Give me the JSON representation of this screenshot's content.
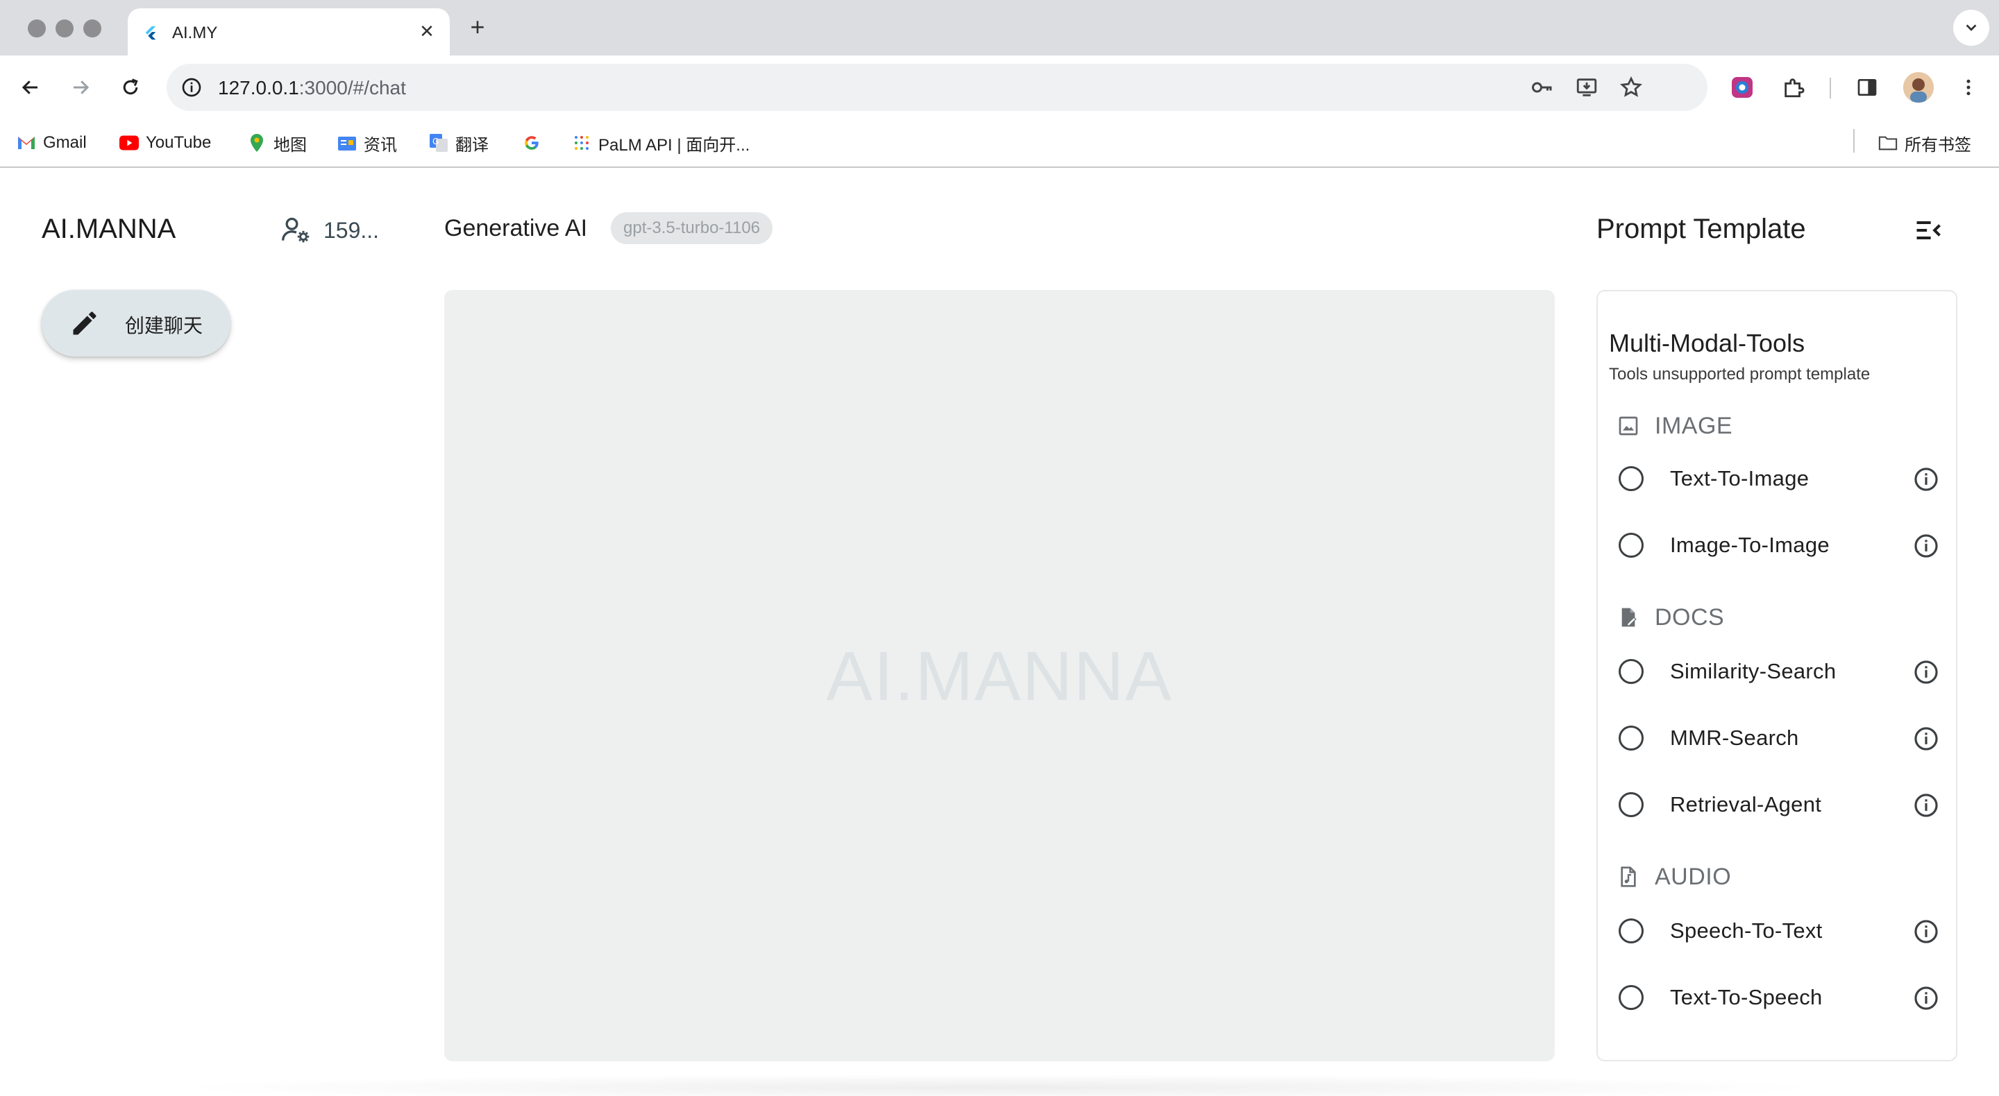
{
  "browser": {
    "tab_title": "AI.MY",
    "url_host": "127.0.0.1",
    "url_rest": ":3000/#/chat",
    "bookmarks": [
      "Gmail",
      "YouTube",
      "地图",
      "资讯",
      "翻译",
      "PaLM API | 面向开..."
    ],
    "all_bookmarks_label": "所有书签"
  },
  "sidebar": {
    "app_title": "AI.MANNA",
    "user_count": "159...",
    "new_chat_label": "创建聊天"
  },
  "main": {
    "title": "Generative AI",
    "model": "gpt-3.5-turbo-1106",
    "watermark": "AI.MANNA"
  },
  "panel": {
    "title": "Prompt Template",
    "heading": "Multi-Modal-Tools",
    "subtitle": "Tools unsupported prompt template",
    "sections": [
      {
        "label": "IMAGE",
        "icon": "image-icon",
        "options": [
          "Text-To-Image",
          "Image-To-Image"
        ]
      },
      {
        "label": "DOCS",
        "icon": "document-icon",
        "options": [
          "Similarity-Search",
          "MMR-Search",
          "Retrieval-Agent"
        ]
      },
      {
        "label": "AUDIO",
        "icon": "audio-file-icon",
        "options": [
          "Speech-To-Text",
          "Text-To-Speech"
        ]
      }
    ]
  },
  "colors": {
    "chat_bg": "#eef0f0",
    "button_bg": "#dfe6e9",
    "chip_bg": "#e4e6e8"
  }
}
